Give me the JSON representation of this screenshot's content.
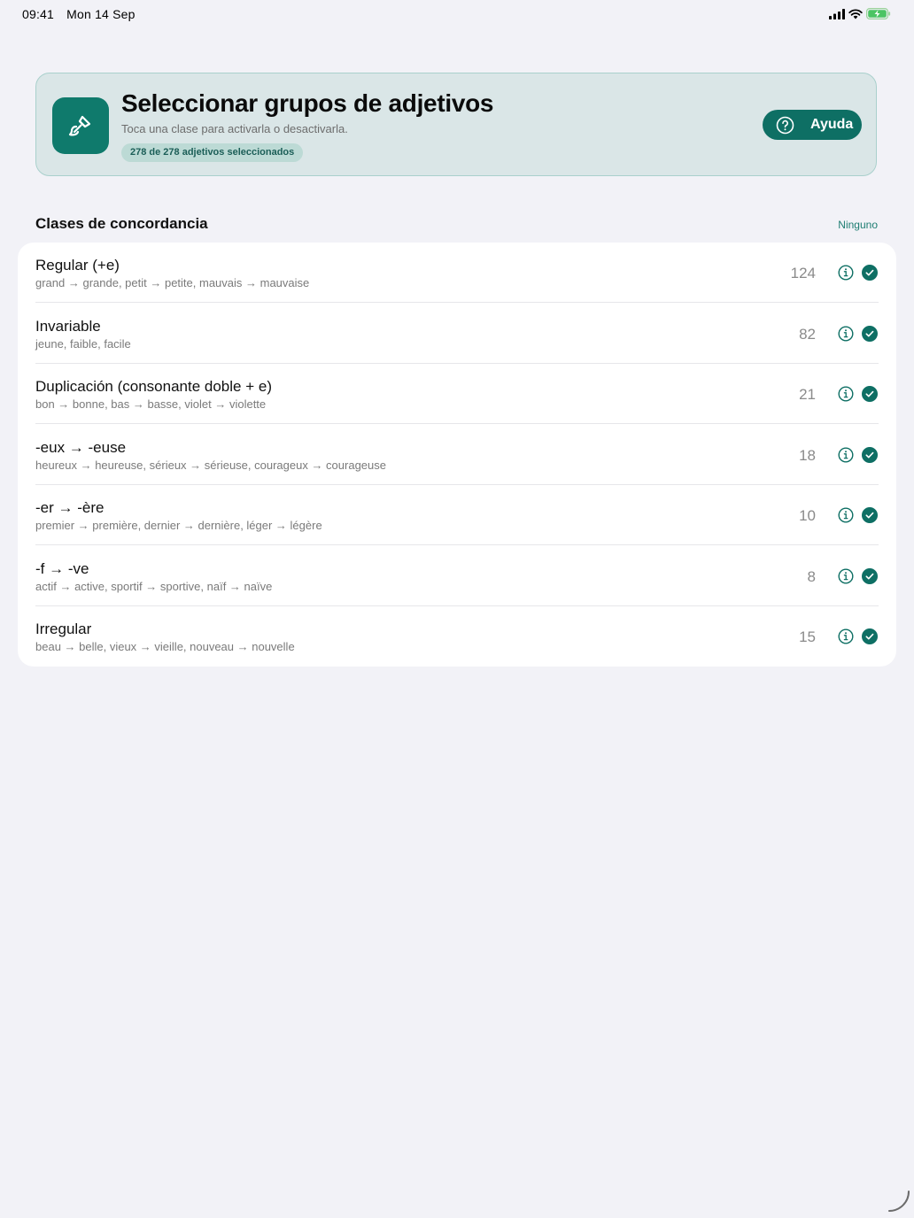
{
  "status": {
    "time": "09:41",
    "date": "Mon 14 Sep",
    "icons": [
      "cellular-signal-icon",
      "wifi-icon",
      "battery-charging-icon"
    ]
  },
  "header": {
    "icon": "paintbrush-icon",
    "title": "Seleccionar grupos de adjetivos",
    "subtitle": "Toca una clase para activarla o desactivarla.",
    "selected_count": "278 de 278 adjetivos seleccionados",
    "help_label": "Ayuda",
    "help_icon": "question-circle-icon"
  },
  "section": {
    "title": "Clases de concordancia",
    "none_label": "Ninguno"
  },
  "classes": [
    {
      "title": "Regular (+e)",
      "examples": "grand → grande, petit → petite, mauvais → mauvaise",
      "count": "124",
      "selected": true
    },
    {
      "title": "Invariable",
      "examples": "jeune, faible, facile",
      "count": "82",
      "selected": true
    },
    {
      "title": "Duplicación (consonante doble + e)",
      "examples": "bon → bonne, bas → basse, violet → violette",
      "count": "21",
      "selected": true
    },
    {
      "title": "-eux → -euse",
      "examples": "heureux → heureuse, sérieux → sérieuse, courageux → courageuse",
      "count": "18",
      "selected": true
    },
    {
      "title": "-er → -ère",
      "examples": "premier → première, dernier → dernière, léger → légère",
      "count": "10",
      "selected": true
    },
    {
      "title": "-f → -ve",
      "examples": "actif → active, sportif → sportive, naïf → naïve",
      "count": "8",
      "selected": true
    },
    {
      "title": "Irregular",
      "examples": "beau → belle, vieux → vieille, nouveau → nouvelle",
      "count": "15",
      "selected": true
    }
  ],
  "colors": {
    "accent": "#0e6f64",
    "header_bg": "#dae6e7",
    "page_bg": "#f2f2f7"
  }
}
